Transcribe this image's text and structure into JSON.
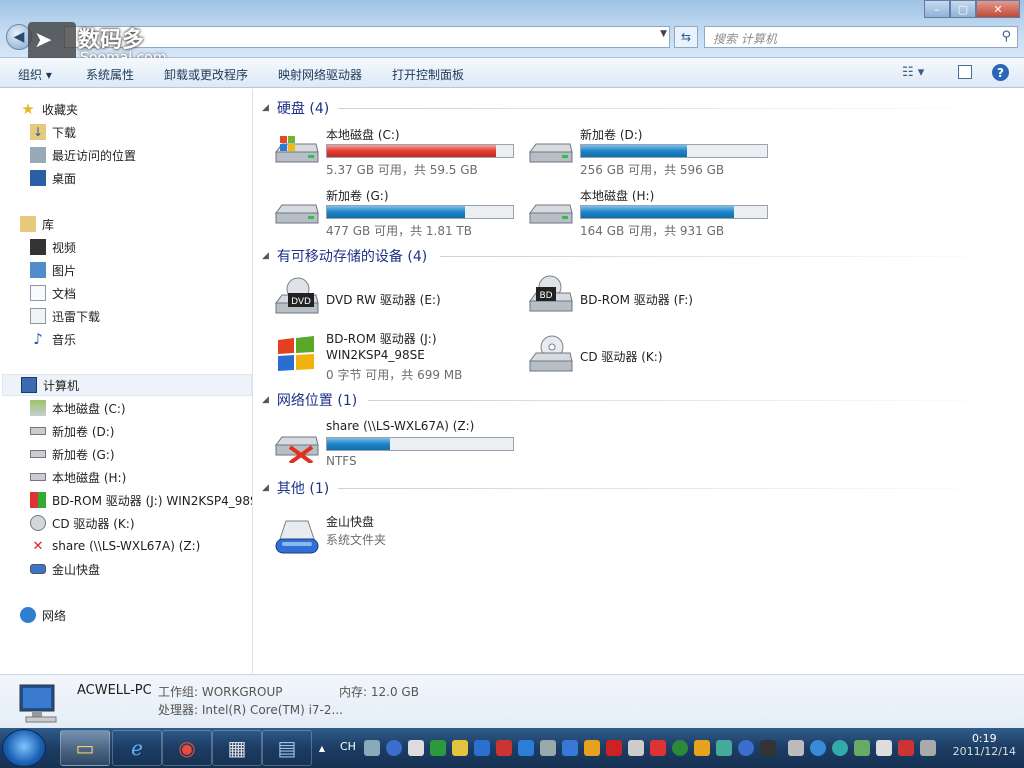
{
  "watermark": {
    "cn": "数码多",
    "en": "Soomal.com"
  },
  "search": {
    "placeholder": "搜索 计算机"
  },
  "toolbar": {
    "organize": "组织 ▾",
    "system_properties": "系统属性",
    "uninstall": "卸载或更改程序",
    "map_drive": "映射网络驱动器",
    "control_panel": "打开控制面板"
  },
  "nav": {
    "favorites": "收藏夹",
    "downloads": "下载",
    "recent": "最近访问的位置",
    "desktop": "桌面",
    "libraries": "库",
    "videos": "视频",
    "pictures": "图片",
    "documents": "文档",
    "thunder": "迅雷下载",
    "music": "音乐",
    "computer": "计算机",
    "drive_c": "本地磁盘 (C:)",
    "drive_d": "新加卷 (D:)",
    "drive_g": "新加卷 (G:)",
    "drive_h": "本地磁盘 (H:)",
    "drive_j": "BD-ROM 驱动器 (J:) WIN2KSP4_98S",
    "drive_k": "CD 驱动器 (K:)",
    "drive_z": "share (\\\\LS-WXL67A) (Z:)",
    "kingsoft": "金山快盘",
    "network": "网络"
  },
  "groups": {
    "hdd": "硬盘 (4)",
    "removable": "有可移动存储的设备 (4)",
    "network": "网络位置 (1)",
    "other": "其他 (1)"
  },
  "drives": {
    "c": {
      "name": "本地磁盘 (C:)",
      "info": "5.37 GB 可用，共 59.5 GB",
      "used": 0.91
    },
    "d": {
      "name": "新加卷 (D:)",
      "info": "256 GB 可用，共 596 GB",
      "used": 0.57
    },
    "g": {
      "name": "新加卷 (G:)",
      "info": "477 GB 可用，共 1.81 TB",
      "used": 0.74
    },
    "h": {
      "name": "本地磁盘 (H:)",
      "info": "164 GB 可用，共 931 GB",
      "used": 0.82
    },
    "e": {
      "name": "DVD RW 驱动器 (E:)",
      "badge": "DVD"
    },
    "f": {
      "name": "BD-ROM 驱动器 (F:)",
      "badge": "BD"
    },
    "j": {
      "name": "BD-ROM 驱动器 (J:)",
      "label": "WIN2KSP4_98SE",
      "info": "0 字节 可用，共 699 MB"
    },
    "k": {
      "name": "CD 驱动器 (K:)"
    },
    "z": {
      "name": "share (\\\\LS-WXL67A) (Z:)",
      "info": "NTFS",
      "used": 0.34
    },
    "kingsoft": {
      "name": "金山快盘",
      "info": "系统文件夹"
    }
  },
  "details": {
    "pc_name": "ACWELL-PC",
    "workgroup": "工作组: WORKGROUP",
    "memory": "内存: 12.0 GB",
    "cpu": "处理器: Intel(R) Core(TM) i7-2..."
  },
  "taskbar": {
    "lang": "CH",
    "time": "0:19",
    "date": "2011/12/14"
  },
  "colors": {
    "accent": "#1e3287",
    "bar_blue": "#1d83c7",
    "bar_red": "#e23b30"
  }
}
